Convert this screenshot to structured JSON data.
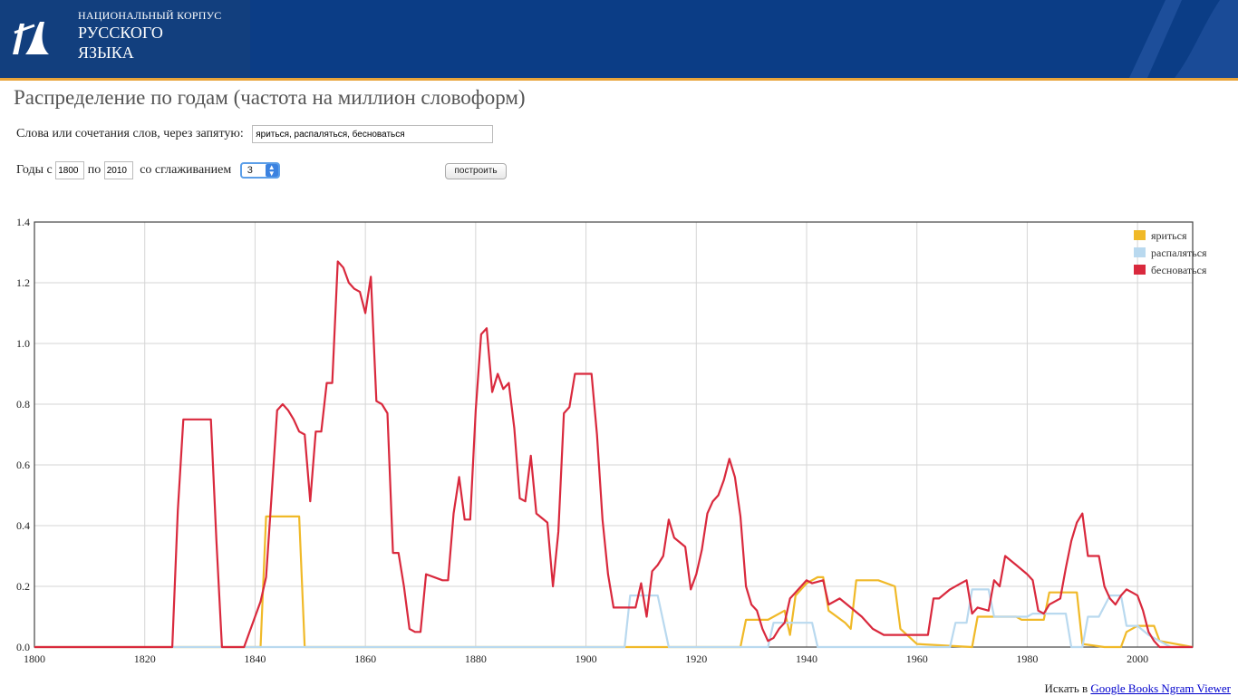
{
  "header": {
    "logo_line1": "НАЦИОНАЛЬНЫЙ КОРПУС",
    "logo_line2": "РУССКОГО",
    "logo_line3": "ЯЗЫКА",
    "colors": {
      "band": "#0b3d86",
      "accent_line": "#e9a53a"
    }
  },
  "page_title": "Распределение по годам (частота на миллион словоформ)",
  "form": {
    "words_label": "Слова или сочетания слов, через запятую:",
    "words_value": "яриться, распаляться, бесноваться",
    "years_from_label": "Годы с",
    "year_from": "1800",
    "years_to_label": "по",
    "year_to": "2010",
    "smoothing_label": "со сглаживанием",
    "smoothing_value": "3",
    "build_button": "построить"
  },
  "footer": {
    "search_prefix": "Искать в",
    "ngram_link": "Google Books Ngram Viewer"
  },
  "chart_data": {
    "type": "line",
    "xlim": [
      1800,
      2010
    ],
    "ylim": [
      0,
      1.4
    ],
    "x_ticks": [
      "1800",
      "1820",
      "1840",
      "1860",
      "1880",
      "1900",
      "1920",
      "1940",
      "1960",
      "1980",
      "2000"
    ],
    "y_ticks": [
      "0.0",
      "0.2",
      "0.4",
      "0.6",
      "0.8",
      "1.0",
      "1.2",
      "1.4"
    ],
    "grid": true,
    "legend_position": "top-right",
    "series": [
      {
        "name": "яриться",
        "color": "#f0b928",
        "points": [
          [
            1800,
            0
          ],
          [
            1841,
            0
          ],
          [
            1842,
            0.43
          ],
          [
            1848,
            0.43
          ],
          [
            1849,
            0
          ],
          [
            1907,
            0
          ],
          [
            1913,
            0
          ],
          [
            1928,
            0
          ],
          [
            1929,
            0.09
          ],
          [
            1933,
            0.09
          ],
          [
            1936,
            0.12
          ],
          [
            1937,
            0.04
          ],
          [
            1938,
            0.17
          ],
          [
            1940,
            0.21
          ],
          [
            1942,
            0.23
          ],
          [
            1943,
            0.23
          ],
          [
            1944,
            0.12
          ],
          [
            1947,
            0.08
          ],
          [
            1948,
            0.06
          ],
          [
            1949,
            0.22
          ],
          [
            1953,
            0.22
          ],
          [
            1956,
            0.2
          ],
          [
            1957,
            0.06
          ],
          [
            1960,
            0.01
          ],
          [
            1970,
            0
          ],
          [
            1971,
            0.1
          ],
          [
            1978,
            0.1
          ],
          [
            1979,
            0.09
          ],
          [
            1983,
            0.09
          ],
          [
            1984,
            0.18
          ],
          [
            1989,
            0.18
          ],
          [
            1990,
            0.01
          ],
          [
            1994,
            0
          ],
          [
            1997,
            0
          ],
          [
            1998,
            0.05
          ],
          [
            2000,
            0.07
          ],
          [
            2002,
            0.07
          ],
          [
            2003,
            0.07
          ],
          [
            2004,
            0.02
          ],
          [
            2010,
            0
          ]
        ]
      },
      {
        "name": "распаляться",
        "color": "#b9d9ef",
        "points": [
          [
            1800,
            0
          ],
          [
            1907,
            0
          ],
          [
            1908,
            0.17
          ],
          [
            1913,
            0.17
          ],
          [
            1915,
            0
          ],
          [
            1933,
            0
          ],
          [
            1934,
            0.08
          ],
          [
            1941,
            0.08
          ],
          [
            1942,
            0
          ],
          [
            1966,
            0
          ],
          [
            1967,
            0.08
          ],
          [
            1969,
            0.08
          ],
          [
            1970,
            0.19
          ],
          [
            1973,
            0.19
          ],
          [
            1974,
            0.1
          ],
          [
            1980,
            0.1
          ],
          [
            1981,
            0.11
          ],
          [
            1987,
            0.11
          ],
          [
            1988,
            0
          ],
          [
            1990,
            0
          ],
          [
            1991,
            0.1
          ],
          [
            1993,
            0.1
          ],
          [
            1995,
            0.17
          ],
          [
            1997,
            0.17
          ],
          [
            1998,
            0.07
          ],
          [
            2000,
            0.07
          ],
          [
            2002,
            0.04
          ],
          [
            2004,
            0.02
          ],
          [
            2006,
            0
          ],
          [
            2010,
            0
          ]
        ]
      },
      {
        "name": "бесноваться",
        "color": "#d9293d",
        "points": [
          [
            1800,
            0
          ],
          [
            1825,
            0
          ],
          [
            1826,
            0.45
          ],
          [
            1827,
            0.75
          ],
          [
            1832,
            0.75
          ],
          [
            1833,
            0.35
          ],
          [
            1834,
            0
          ],
          [
            1838,
            0
          ],
          [
            1841,
            0.15
          ],
          [
            1842,
            0.23
          ],
          [
            1843,
            0.5
          ],
          [
            1844,
            0.78
          ],
          [
            1845,
            0.8
          ],
          [
            1846,
            0.78
          ],
          [
            1847,
            0.75
          ],
          [
            1848,
            0.71
          ],
          [
            1849,
            0.7
          ],
          [
            1850,
            0.48
          ],
          [
            1851,
            0.71
          ],
          [
            1852,
            0.71
          ],
          [
            1853,
            0.87
          ],
          [
            1854,
            0.87
          ],
          [
            1855,
            1.27
          ],
          [
            1856,
            1.25
          ],
          [
            1857,
            1.2
          ],
          [
            1858,
            1.18
          ],
          [
            1859,
            1.17
          ],
          [
            1860,
            1.1
          ],
          [
            1861,
            1.22
          ],
          [
            1862,
            0.81
          ],
          [
            1863,
            0.8
          ],
          [
            1864,
            0.77
          ],
          [
            1865,
            0.31
          ],
          [
            1866,
            0.31
          ],
          [
            1867,
            0.2
          ],
          [
            1868,
            0.06
          ],
          [
            1869,
            0.05
          ],
          [
            1870,
            0.05
          ],
          [
            1871,
            0.24
          ],
          [
            1874,
            0.22
          ],
          [
            1875,
            0.22
          ],
          [
            1876,
            0.44
          ],
          [
            1877,
            0.56
          ],
          [
            1878,
            0.42
          ],
          [
            1879,
            0.42
          ],
          [
            1880,
            0.78
          ],
          [
            1881,
            1.03
          ],
          [
            1882,
            1.05
          ],
          [
            1883,
            0.84
          ],
          [
            1884,
            0.9
          ],
          [
            1885,
            0.85
          ],
          [
            1886,
            0.87
          ],
          [
            1887,
            0.72
          ],
          [
            1888,
            0.49
          ],
          [
            1889,
            0.48
          ],
          [
            1890,
            0.63
          ],
          [
            1891,
            0.44
          ],
          [
            1893,
            0.41
          ],
          [
            1894,
            0.2
          ],
          [
            1895,
            0.38
          ],
          [
            1896,
            0.77
          ],
          [
            1897,
            0.79
          ],
          [
            1898,
            0.9
          ],
          [
            1901,
            0.9
          ],
          [
            1902,
            0.7
          ],
          [
            1903,
            0.42
          ],
          [
            1904,
            0.24
          ],
          [
            1905,
            0.13
          ],
          [
            1909,
            0.13
          ],
          [
            1910,
            0.21
          ],
          [
            1911,
            0.1
          ],
          [
            1912,
            0.25
          ],
          [
            1913,
            0.27
          ],
          [
            1914,
            0.3
          ],
          [
            1915,
            0.42
          ],
          [
            1916,
            0.36
          ],
          [
            1918,
            0.33
          ],
          [
            1919,
            0.19
          ],
          [
            1920,
            0.24
          ],
          [
            1921,
            0.32
          ],
          [
            1922,
            0.44
          ],
          [
            1923,
            0.48
          ],
          [
            1924,
            0.5
          ],
          [
            1925,
            0.55
          ],
          [
            1926,
            0.62
          ],
          [
            1927,
            0.56
          ],
          [
            1928,
            0.43
          ],
          [
            1929,
            0.2
          ],
          [
            1930,
            0.14
          ],
          [
            1931,
            0.12
          ],
          [
            1932,
            0.06
          ],
          [
            1933,
            0.02
          ],
          [
            1934,
            0.03
          ],
          [
            1935,
            0.06
          ],
          [
            1936,
            0.08
          ],
          [
            1937,
            0.16
          ],
          [
            1938,
            0.18
          ],
          [
            1939,
            0.2
          ],
          [
            1940,
            0.22
          ],
          [
            1941,
            0.21
          ],
          [
            1943,
            0.22
          ],
          [
            1944,
            0.14
          ],
          [
            1946,
            0.16
          ],
          [
            1948,
            0.13
          ],
          [
            1950,
            0.1
          ],
          [
            1952,
            0.06
          ],
          [
            1954,
            0.04
          ],
          [
            1956,
            0.04
          ],
          [
            1960,
            0.04
          ],
          [
            1962,
            0.04
          ],
          [
            1963,
            0.16
          ],
          [
            1964,
            0.16
          ],
          [
            1966,
            0.19
          ],
          [
            1968,
            0.21
          ],
          [
            1969,
            0.22
          ],
          [
            1970,
            0.11
          ],
          [
            1971,
            0.13
          ],
          [
            1973,
            0.12
          ],
          [
            1974,
            0.22
          ],
          [
            1975,
            0.2
          ],
          [
            1976,
            0.3
          ],
          [
            1978,
            0.27
          ],
          [
            1980,
            0.24
          ],
          [
            1981,
            0.22
          ],
          [
            1982,
            0.12
          ],
          [
            1983,
            0.11
          ],
          [
            1984,
            0.14
          ],
          [
            1986,
            0.16
          ],
          [
            1987,
            0.26
          ],
          [
            1988,
            0.35
          ],
          [
            1989,
            0.41
          ],
          [
            1990,
            0.44
          ],
          [
            1991,
            0.3
          ],
          [
            1993,
            0.3
          ],
          [
            1994,
            0.2
          ],
          [
            1995,
            0.16
          ],
          [
            1996,
            0.14
          ],
          [
            1997,
            0.17
          ],
          [
            1998,
            0.19
          ],
          [
            1999,
            0.18
          ],
          [
            2000,
            0.17
          ],
          [
            2001,
            0.12
          ],
          [
            2002,
            0.05
          ],
          [
            2003,
            0.02
          ],
          [
            2004,
            0
          ],
          [
            2010,
            0
          ]
        ]
      }
    ]
  }
}
